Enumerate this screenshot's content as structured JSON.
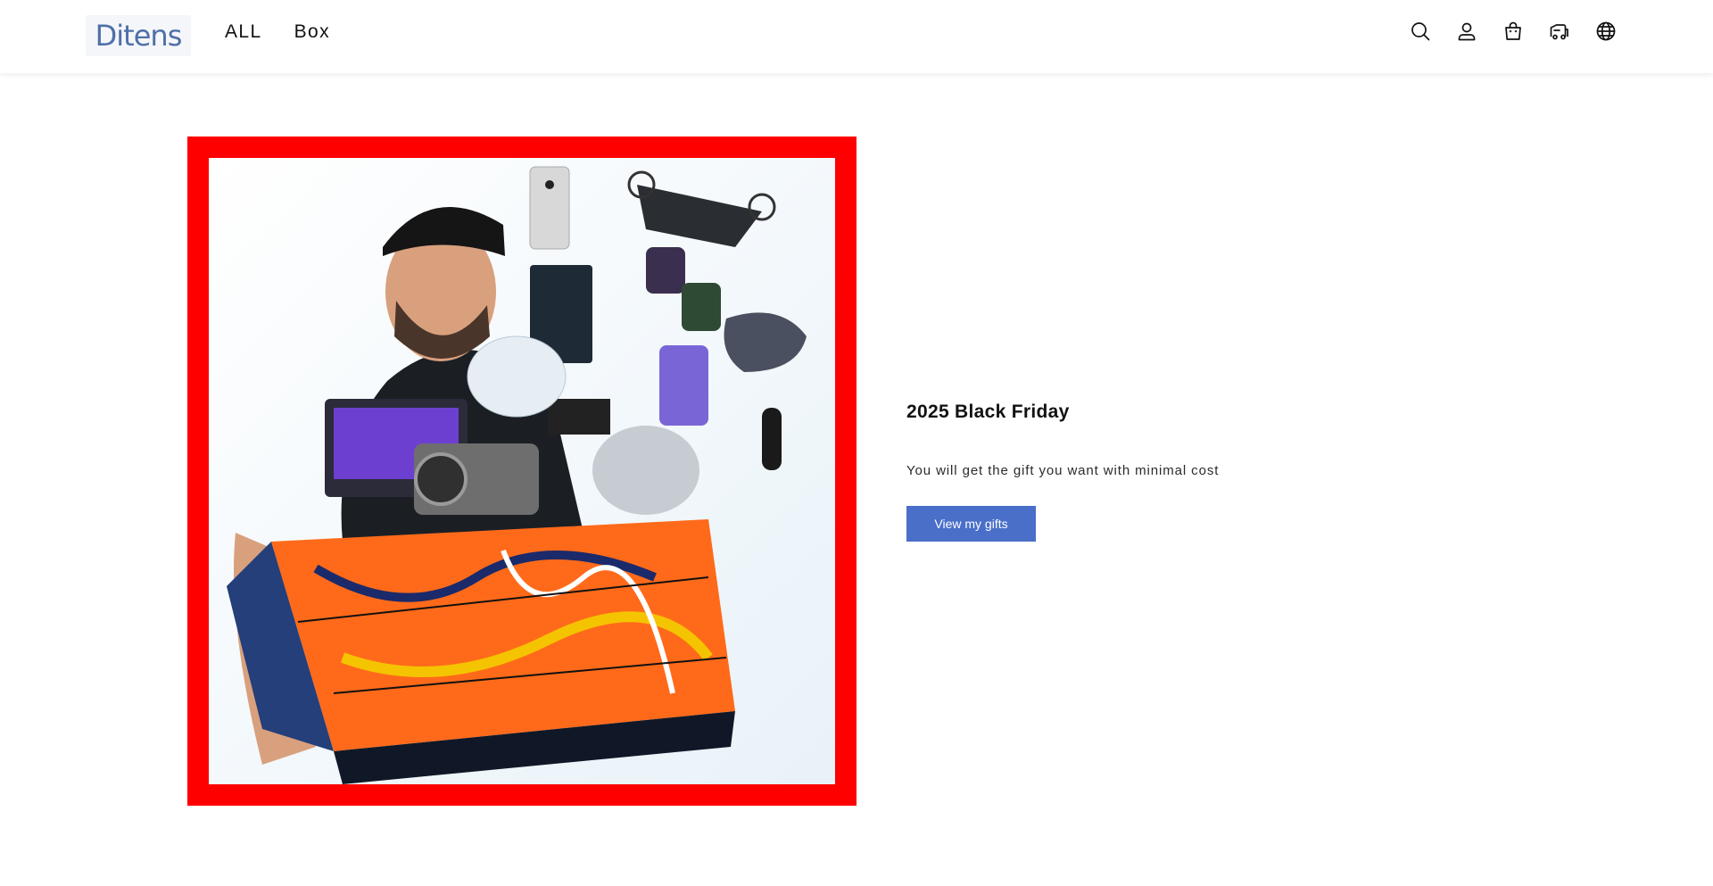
{
  "header": {
    "logo_text": "Ditens",
    "nav": [
      {
        "label": "ALL"
      },
      {
        "label": "Box"
      }
    ],
    "icons": [
      "search-icon",
      "account-icon",
      "cart-icon",
      "truck-icon",
      "globe-icon"
    ]
  },
  "hero": {
    "title": "2025 Black Friday",
    "description": "You will get the gift you want with minimal cost",
    "cta_label": "View my gifts",
    "frame_color": "#ff0000",
    "cta_color": "#4a6fc9"
  }
}
